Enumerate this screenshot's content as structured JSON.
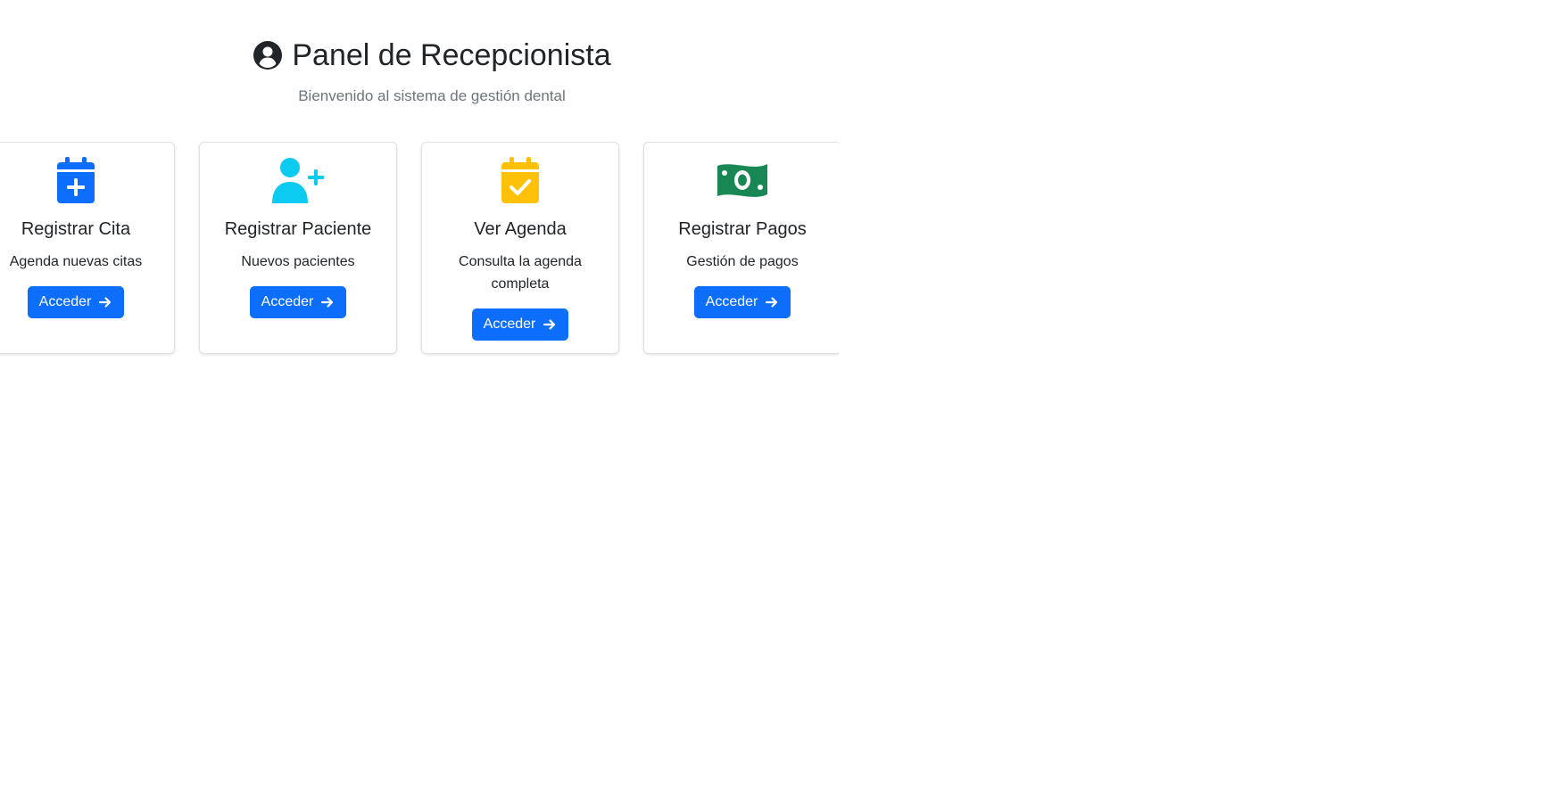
{
  "header": {
    "title": "Panel de Recepcionista",
    "subtitle": "Bienvenido al sistema de gestión dental",
    "icon": "user-circle-icon"
  },
  "cards": [
    {
      "icon": "calendar-plus-icon",
      "icon_color": "#0d6efd",
      "title": "Registrar Cita",
      "description": "Agenda nuevas citas",
      "button_label": "Acceder"
    },
    {
      "icon": "user-plus-icon",
      "icon_color": "#0dcaf0",
      "title": "Registrar Paciente",
      "description": "Nuevos pacientes",
      "button_label": "Acceder"
    },
    {
      "icon": "calendar-check-icon",
      "icon_color": "#ffc107",
      "title": "Ver Agenda",
      "description": "Consulta la agenda completa",
      "button_label": "Acceder"
    },
    {
      "icon": "money-bill-icon",
      "icon_color": "#198754",
      "title": "Registrar Pagos",
      "description": "Gestión de pagos",
      "button_label": "Acceder"
    }
  ],
  "colors": {
    "primary": "#0d6efd",
    "info": "#0dcaf0",
    "warning": "#ffc107",
    "success": "#198754"
  }
}
